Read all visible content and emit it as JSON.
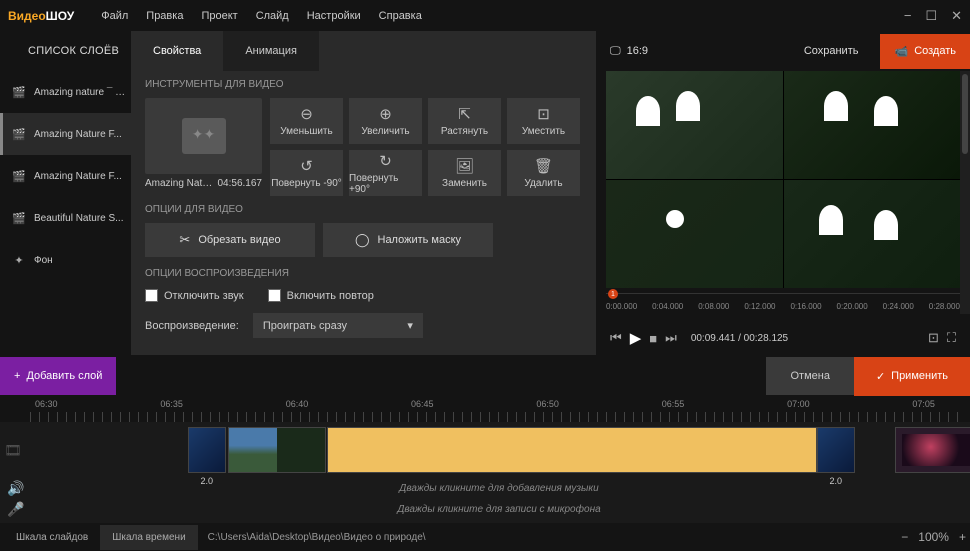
{
  "app": {
    "name1": "Видео",
    "name2": "ШОУ"
  },
  "menu": [
    "Файл",
    "Правка",
    "Проект",
    "Слайд",
    "Настройки",
    "Справка"
  ],
  "sidebar": {
    "title": "СПИСОК СЛОЁВ",
    "layers": [
      {
        "name": "Amazing nature ¯ S..."
      },
      {
        "name": "Amazing Nature F..."
      },
      {
        "name": "Amazing Nature F..."
      },
      {
        "name": "Beautiful Nature S..."
      },
      {
        "name": "Фон"
      }
    ]
  },
  "tabs": {
    "props": "Свойства",
    "anim": "Анимация"
  },
  "tools": {
    "section": "ИНСТРУМЕНТЫ ДЛЯ ВИДЕО",
    "name": "Amazing Natur...",
    "dur": "04:56.167",
    "buttons": [
      {
        "icon": "⊖",
        "label": "Уменьшить"
      },
      {
        "icon": "⊕",
        "label": "Увеличить"
      },
      {
        "icon": "⇱",
        "label": "Растянуть"
      },
      {
        "icon": "⊡",
        "label": "Уместить"
      },
      {
        "icon": "↺",
        "label": "Повернуть -90°"
      },
      {
        "icon": "↻",
        "label": "Повернуть +90°"
      },
      {
        "icon": "🖼",
        "label": "Заменить"
      },
      {
        "icon": "🗑",
        "label": "Удалить"
      }
    ]
  },
  "opts": {
    "section": "ОПЦИИ ДЛЯ ВИДЕО",
    "trim": "Обрезать видео",
    "mask": "Наложить маску",
    "playback": "ОПЦИИ ВОСПРОИЗВЕДЕНИЯ",
    "mute": "Отключить звук",
    "loop": "Включить повтор",
    "pblabel": "Воспроизведение:",
    "pbval": "Проиграть сразу"
  },
  "preview": {
    "ratio": "16:9",
    "save": "Сохранить",
    "create": "Создать",
    "ticks": [
      "0:00.000",
      "0:04.000",
      "0:08.000",
      "0:12.000",
      "0:16.000",
      "0:20.000",
      "0:24.000",
      "0:28.000"
    ],
    "marker": "1",
    "time": "00:09.441 / 00:28.125"
  },
  "actions": {
    "add": "Добавить слой",
    "cancel": "Отмена",
    "apply": "Применить"
  },
  "tl": {
    "times": [
      "06:30",
      "06:35",
      "06:40",
      "06:45",
      "06:50",
      "06:55",
      "07:00",
      "07:05"
    ],
    "trans": "2.0",
    "music": "Дважды кликните для добавления музыки",
    "mic": "Дважды кликните для записи с микрофона"
  },
  "status": {
    "slides": "Шкала слайдов",
    "time": "Шкала времени",
    "path": "C:\\Users\\Aida\\Desktop\\Видео\\Видео о природе\\",
    "zoom": "100%"
  }
}
